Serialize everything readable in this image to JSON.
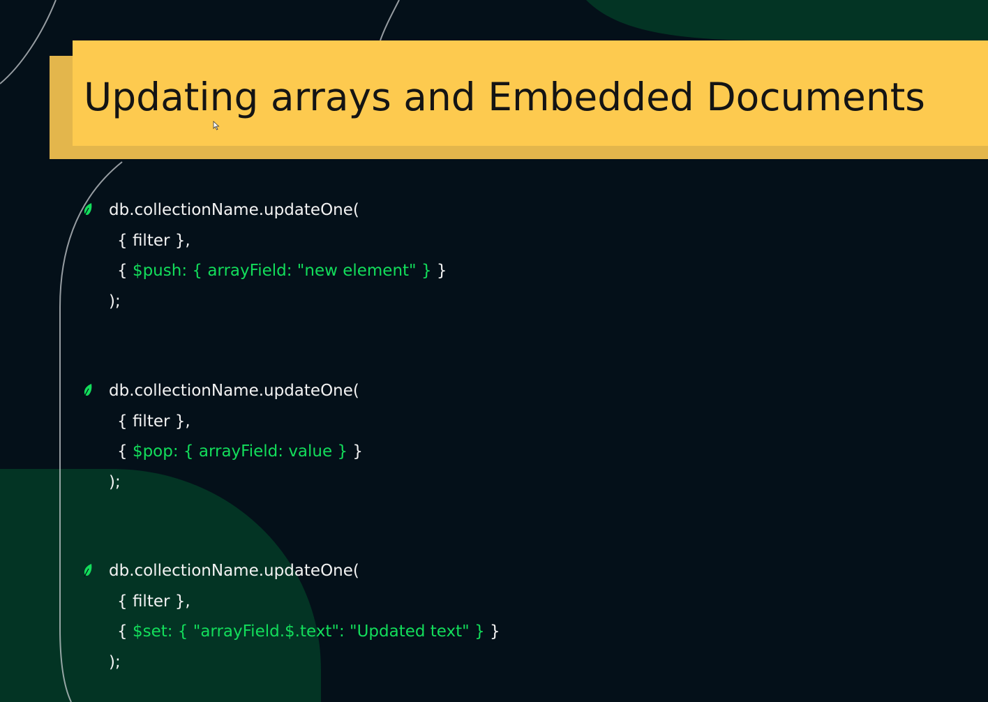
{
  "slide": {
    "title": "Updating arrays and Embedded Documents",
    "colors": {
      "background": "#041019",
      "title_band": "#fdca4f",
      "title_band_shadow": "#e3b64c",
      "code_text": "#f3f3f3",
      "code_highlight": "#13dd5b",
      "decor_green": "#033424",
      "leaf": "#13dd5b"
    },
    "bullet_icon": "leaf-icon",
    "code_blocks": [
      {
        "call": "db.collectionName.updateOne(",
        "filter": "{ filter },",
        "op_open": "{ ",
        "op": "$push: { arrayField: \"new element\" }",
        "op_close": " }",
        "end": ");"
      },
      {
        "call": "db.collectionName.updateOne(",
        "filter": "{ filter },",
        "op_open": "{ ",
        "op": "$pop: { arrayField: value }",
        "op_close": " }",
        "end": ");"
      },
      {
        "call": "db.collectionName.updateOne(",
        "filter": "{ filter },",
        "op_open": "{ ",
        "op": "$set: { \"arrayField.$.text\": \"Updated text\" }",
        "op_close": " }",
        "end": ");"
      }
    ]
  }
}
